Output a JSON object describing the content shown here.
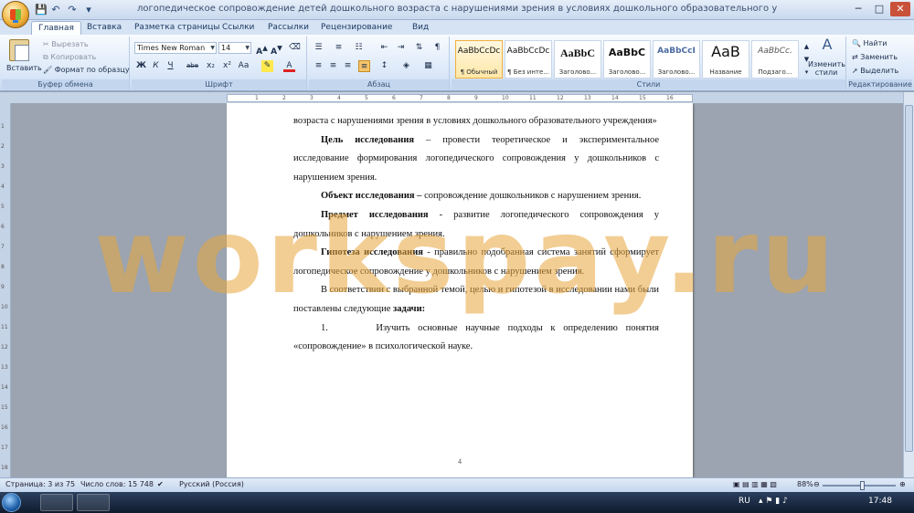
{
  "window": {
    "title": "логопедическое сопровождение детей дошкольного возраста с нарушениями зрения в условиях дошкольного образовательного учреждения - Microsoft Word",
    "minimize": "─",
    "maximize": "□",
    "close": "✕"
  },
  "tabs": [
    "Главная",
    "Вставка",
    "Разметка страницы",
    "Ссылки",
    "Рассылки",
    "Рецензирование",
    "Вид"
  ],
  "ribbon": {
    "clipboard": {
      "label": "Буфер обмена",
      "paste": "Вставить",
      "cut": "Вырезать",
      "copy": "Копировать",
      "format_painter": "Формат по образцу"
    },
    "font": {
      "label": "Шрифт",
      "name": "Times New Roman",
      "size": "14"
    },
    "paragraph": {
      "label": "Абзац"
    },
    "styles": {
      "label": "Стили",
      "items": [
        {
          "sample": "AaBbCcDc",
          "name": "¶ Обычный"
        },
        {
          "sample": "AaBbCcDc",
          "name": "¶ Без инте..."
        },
        {
          "sample": "AaBbC",
          "name": "Заголово..."
        },
        {
          "sample": "AaBbC",
          "name": "Заголово..."
        },
        {
          "sample": "AaBbCcI",
          "name": "Заголово..."
        },
        {
          "sample": "AaB",
          "name": "Название"
        },
        {
          "sample": "AaBbCc.",
          "name": "Подзаго..."
        }
      ],
      "change_styles": "Изменить стили"
    },
    "editing": {
      "label": "Редактирование",
      "find": "Найти",
      "replace": "Заменить",
      "select": "Выделить"
    }
  },
  "document": {
    "line1": "возраста с нарушениями зрения в условиях дошкольного образовательного учреждения»",
    "goal_label": "Цель исследования",
    "goal_text": " – провести теоретическое и экспериментальное исследование формирования логопедического сопровождения у дошкольников с нарушением зрения.",
    "object_label": "Объект исследования –",
    "object_text": " сопровождение дошкольников с нарушением зрения.",
    "subject_label": "Предмет исследования",
    "subject_text": " - развитие логопедического сопровождения у дошкольников с нарушением зрения.",
    "hypothesis_label": "Гипотеза исследования",
    "hypothesis_text": " - правильно подобранная система занятий сформирует логопедическое сопровождение у дошкольников с нарушением зрения.",
    "tasks_intro": "В соответствии с выбранной темой, целью и гипотезой в исследовании нами были поставлены следующие ",
    "tasks_label": "задачи:",
    "task1_num": "1.",
    "task1_text": "Изучить основные научные подходы к определению понятия «сопровождение» в психологической науке.",
    "page_number": "4"
  },
  "watermark": "workspay.ru",
  "statusbar": {
    "page": "Страница: 3 из 75",
    "words": "Число слов: 15 748",
    "language": "Русский (Россия)",
    "zoom": "88%",
    "zoom_fraction": 0.55
  },
  "taskbar": {
    "lang": "RU",
    "time": "17:48"
  }
}
